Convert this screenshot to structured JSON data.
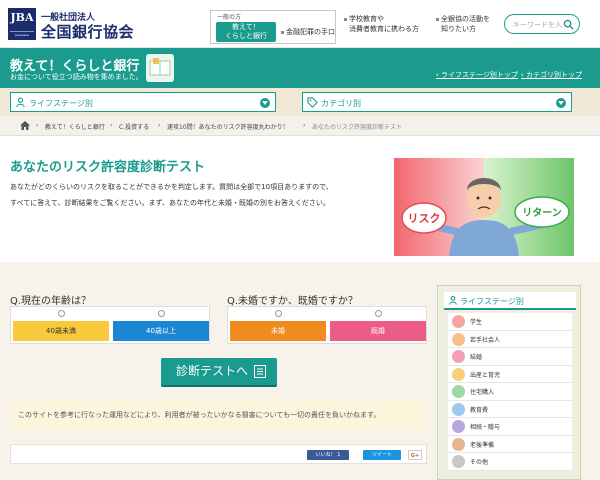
{
  "header": {
    "logo_mark": "JBA",
    "logo_mark_sub": "Japanese Bankers Association",
    "org_type": "一般社団法人",
    "org_name": "全国銀行協会",
    "nav_group_label": "一般の方",
    "nav_active": [
      "教えて！",
      "くらしと銀行"
    ],
    "nav_items": [
      [
        "金融犯罪の手口"
      ],
      [
        "学校教育や",
        "消費者教育に携わる方"
      ],
      [
        "全銀協の活動を",
        "知りたい方"
      ]
    ],
    "search_placeholder": "キーワードを入",
    "colors": {
      "brand": "#1a2c6b",
      "accent": "#1a9b8e"
    }
  },
  "band": {
    "title": "教えて！くらしと銀行",
    "subtitle": "お金について役立つ読み物を集めました。",
    "links": [
      "ライフステージ別トップ",
      "カテゴリ別トップ"
    ]
  },
  "selectors": {
    "life_stage": "ライフステージ別",
    "category": "カテゴリ別"
  },
  "breadcrumb": [
    "教えて！くらしと銀行",
    "C.投資する",
    "速攻10問！あなたのリスク許容度丸わかり！",
    "あなたのリスク許容度診断テスト"
  ],
  "intro": {
    "title": "あなたのリスク許容度診断テスト",
    "body": [
      "あなたがどのくらいのリスクを取ることができるかを判定します。質問は全部で10項目ありますので、",
      "すべてに答えて、診断結果をご覧ください。まず、あなたの年代と未婚・既婚の別をお答えください。"
    ],
    "hero_risk": "リスク",
    "hero_return": "リターン"
  },
  "quiz": {
    "q1": {
      "title": "Q.現在の年齢は？",
      "options": [
        "40歳未満",
        "40歳以上"
      ]
    },
    "q2": {
      "title": "Q.未婚ですか、既婚ですか？",
      "options": [
        "未婚",
        "既婚"
      ]
    },
    "submit": "診断テストへ",
    "disclaimer": "このサイトを参考に行なった運用などにより、利用者が被ったいかなる損害についても一切の責任を負いかねます。",
    "share": {
      "facebook": "いいね！ 1",
      "twitter": "ツイート",
      "google": "G+"
    }
  },
  "sidebar": {
    "title": "ライフステージ別",
    "items": [
      {
        "label": "学生",
        "color": "#f6a5a5"
      },
      {
        "label": "若手社会人",
        "color": "#f3c08a"
      },
      {
        "label": "結婚",
        "color": "#f49fb5"
      },
      {
        "label": "出産と育児",
        "color": "#f7cf7a"
      },
      {
        "label": "住宅購入",
        "color": "#9fd6a3"
      },
      {
        "label": "教育費",
        "color": "#9ec9ee"
      },
      {
        "label": "相続・贈与",
        "color": "#b8a6dc"
      },
      {
        "label": "老後準備",
        "color": "#e8b48d"
      },
      {
        "label": "その他",
        "color": "#c7c7c7"
      }
    ]
  }
}
